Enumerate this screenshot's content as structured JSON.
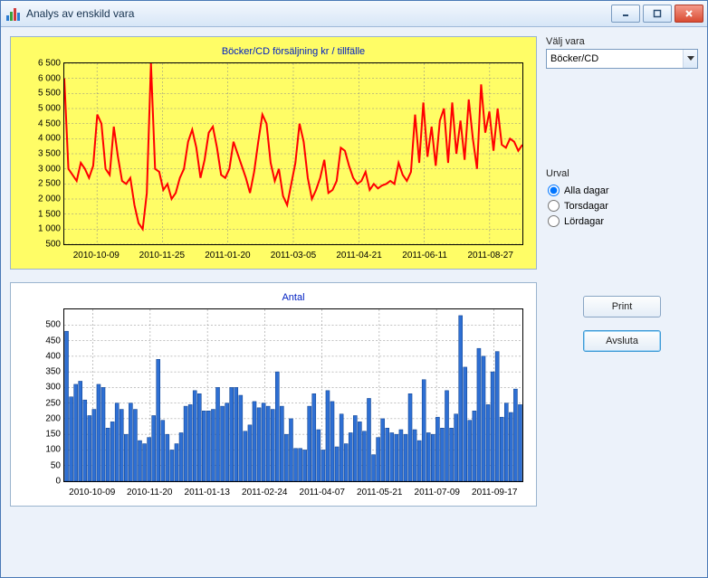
{
  "window": {
    "title": "Analys av enskild vara"
  },
  "side": {
    "select_label": "Välj vara",
    "select_value": "Böcker/CD",
    "urval_label": "Urval",
    "radios": [
      {
        "label": "Alla dagar",
        "checked": true
      },
      {
        "label": "Torsdagar",
        "checked": false
      },
      {
        "label": "Lördagar",
        "checked": false
      }
    ],
    "print_label": "Print",
    "close_label": "Avsluta"
  },
  "chart_data": [
    {
      "type": "line",
      "title": "Böcker/CD  försäljning  kr / tillfälle",
      "ylim": [
        500,
        6500
      ],
      "yticks": [
        500,
        1000,
        1500,
        2000,
        2500,
        3000,
        3500,
        4000,
        4500,
        5000,
        5500,
        6000,
        6500
      ],
      "xticks": [
        "2010-10-09",
        "2010-11-25",
        "2011-01-20",
        "2011-03-05",
        "2011-04-21",
        "2011-06-11",
        "2011-08-27"
      ],
      "values": [
        6000,
        3000,
        2800,
        2600,
        3200,
        3000,
        2700,
        3100,
        4800,
        4500,
        3000,
        2800,
        4400,
        3400,
        2600,
        2500,
        2700,
        1800,
        1200,
        1000,
        2200,
        6500,
        3000,
        2900,
        2300,
        2500,
        2000,
        2200,
        2700,
        3000,
        3900,
        4300,
        3700,
        2700,
        3300,
        4200,
        4400,
        3700,
        2800,
        2700,
        3000,
        3900,
        3500,
        3100,
        2700,
        2200,
        2900,
        3900,
        4800,
        4500,
        3200,
        2600,
        3000,
        2100,
        1800,
        2500,
        3200,
        4500,
        3900,
        2700,
        2000,
        2300,
        2700,
        3300,
        2200,
        2300,
        2600,
        3700,
        3600,
        3100,
        2700,
        2500,
        2600,
        2900,
        2300,
        2500,
        2350,
        2450,
        2500,
        2600,
        2500,
        3200,
        2800,
        2600,
        2900,
        4800,
        3200,
        5200,
        3400,
        4400,
        3100,
        4600,
        5000,
        3200,
        5200,
        3500,
        4600,
        3300,
        5300,
        4000,
        3000,
        5800,
        4200,
        4900,
        3600,
        5000,
        3800,
        3700,
        4000,
        3900,
        3600,
        3800
      ]
    },
    {
      "type": "bar",
      "title": "Antal",
      "ylim": [
        0,
        550
      ],
      "yticks": [
        0,
        50,
        100,
        150,
        200,
        250,
        300,
        350,
        400,
        450,
        500
      ],
      "xticks": [
        "2010-10-09",
        "2010-11-20",
        "2011-01-13",
        "2011-02-24",
        "2011-04-07",
        "2011-05-21",
        "2011-07-09",
        "2011-09-17"
      ],
      "values": [
        480,
        270,
        310,
        320,
        260,
        210,
        230,
        310,
        300,
        170,
        190,
        250,
        230,
        150,
        250,
        230,
        130,
        120,
        140,
        210,
        390,
        195,
        150,
        100,
        120,
        155,
        240,
        245,
        290,
        280,
        225,
        225,
        230,
        300,
        240,
        250,
        300,
        300,
        275,
        160,
        180,
        255,
        235,
        250,
        240,
        230,
        350,
        240,
        150,
        200,
        105,
        105,
        100,
        240,
        280,
        165,
        100,
        290,
        255,
        110,
        215,
        120,
        155,
        210,
        190,
        160,
        265,
        85,
        140,
        200,
        170,
        155,
        150,
        165,
        150,
        280,
        165,
        130,
        325,
        155,
        150,
        205,
        170,
        290,
        170,
        215,
        530,
        365,
        195,
        225,
        425,
        400,
        245,
        350,
        415,
        205,
        250,
        220,
        295,
        245
      ]
    }
  ]
}
